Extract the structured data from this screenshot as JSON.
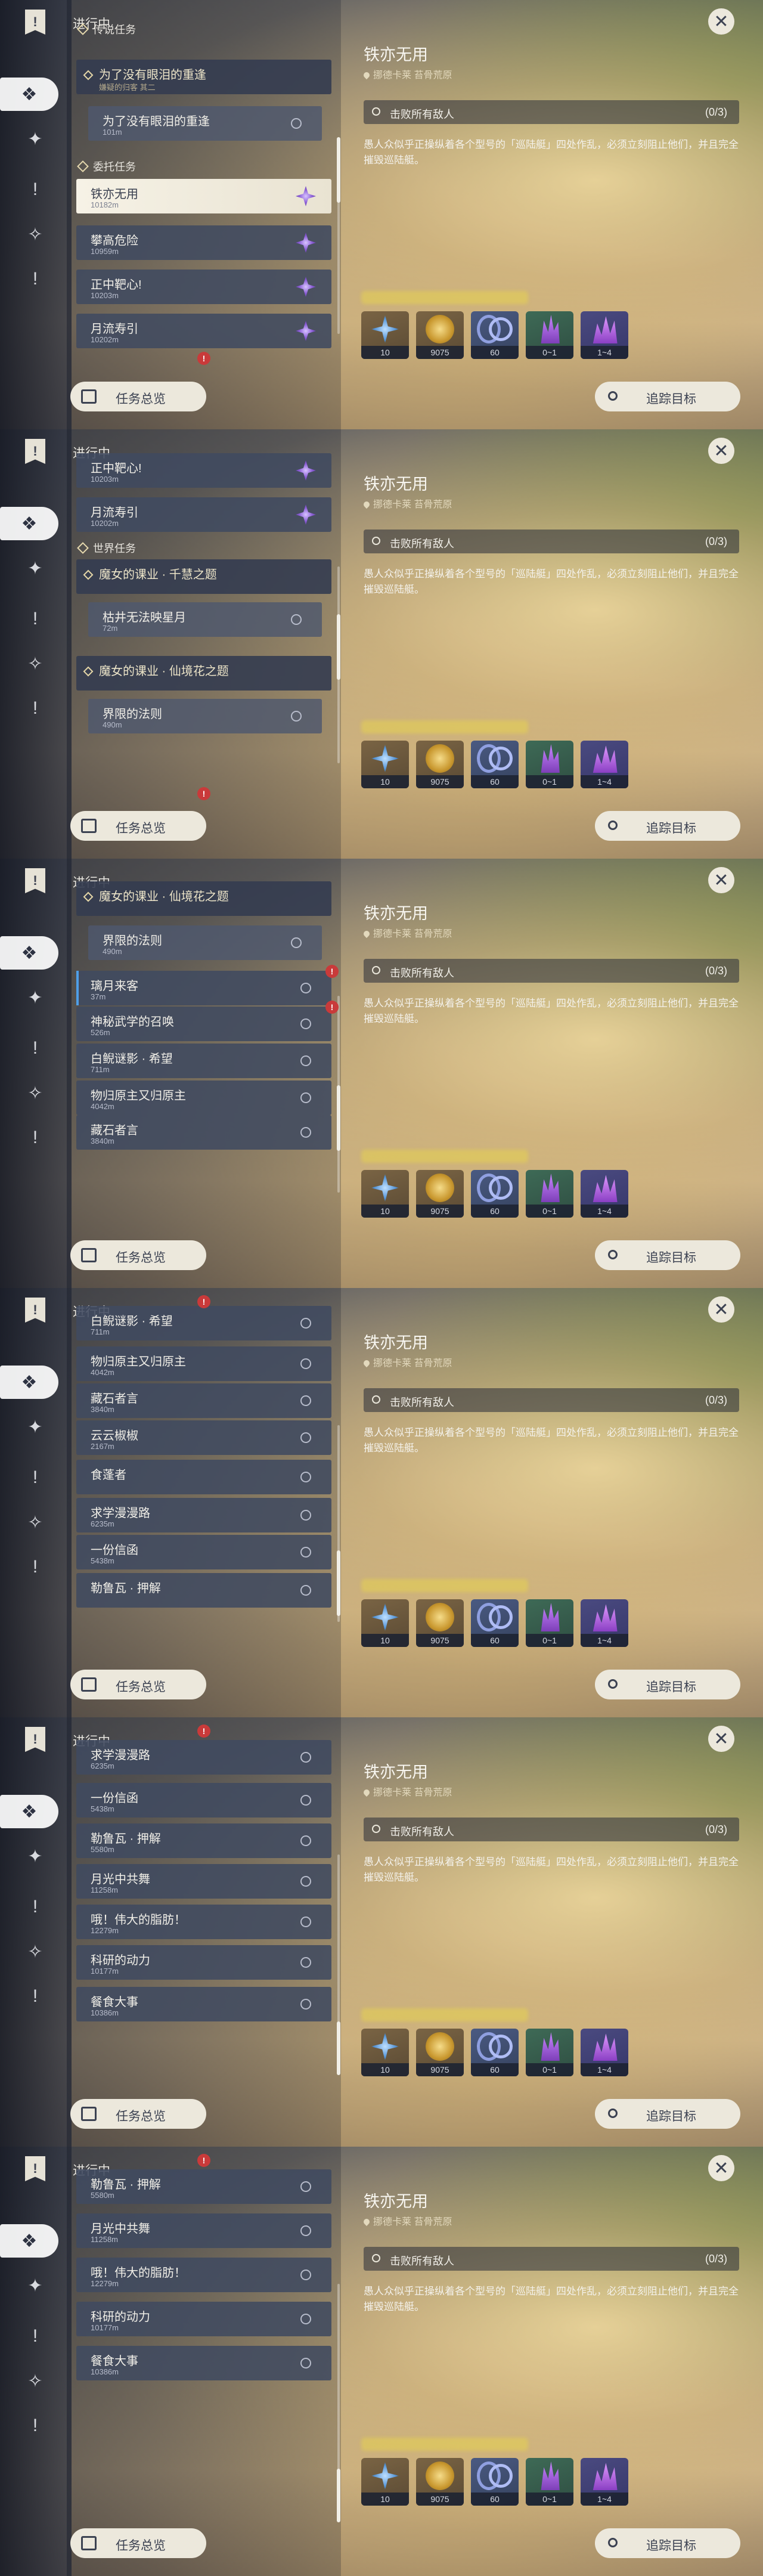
{
  "rail": {
    "top_icon": "!",
    "icons": [
      "quest-diamond-icon",
      "compass-icon",
      "exclamation-icon",
      "tangle-icon",
      "exclamation-icon"
    ]
  },
  "left": {
    "panel_title": "进行中",
    "overview_label": "任务总览"
  },
  "detail": {
    "title": "铁亦无用",
    "location": "挪德卡莱 苔骨荒原",
    "objective": "击败所有敌人",
    "progress": "(0/3)",
    "description": "愚人众似乎正操纵着各个型号的「巡陆艇」四处作乱，必须立刻阻止他们，并且完全摧毁巡陆艇。",
    "rewards": [
      {
        "name": "crystal-reward",
        "count": "10"
      },
      {
        "name": "mora-reward",
        "count": "9075"
      },
      {
        "name": "exp-reward",
        "count": "60"
      },
      {
        "name": "ore-reward",
        "count": "0~1"
      },
      {
        "name": "crystal-cluster-reward",
        "count": "1~4"
      }
    ],
    "track_label": "追踪目标",
    "close_label": "✕"
  },
  "shots": [
    {
      "items": [
        {
          "kind": "section",
          "top": 0,
          "label": "传说任务",
          "icon": "!"
        },
        {
          "kind": "gold",
          "title": "为了没有眼泪的重逢",
          "dist": "嫌疑的归客 其二"
        },
        {
          "kind": "sub",
          "title": "为了没有眼泪的重逢",
          "dist": "101m"
        },
        {
          "kind": "section",
          "label": "委托任务"
        },
        {
          "kind": "active",
          "title": "铁亦无用",
          "dist": "10182m",
          "gem": true
        },
        {
          "kind": "normal",
          "title": "攀高危险",
          "dist": "10959m",
          "gem": true
        },
        {
          "kind": "normal",
          "title": "正中靶心!",
          "dist": "10203m",
          "gem": true
        },
        {
          "kind": "normal",
          "title": "月流寿引",
          "dist": "10202m",
          "gem": true
        }
      ]
    },
    {
      "items": [
        {
          "kind": "normal",
          "title": "正中靶心!",
          "dist": "10203m",
          "gem": true
        },
        {
          "kind": "normal",
          "title": "月流寿引",
          "dist": "10202m",
          "gem": true
        },
        {
          "kind": "section",
          "label": "世界任务",
          "icon": "!"
        },
        {
          "kind": "gold",
          "title": "魔女的课业 · 千慧之题",
          "dist": ""
        },
        {
          "kind": "sub",
          "title": "枯井无法映星月",
          "dist": "72m"
        },
        {
          "kind": "gold",
          "title": "魔女的课业 · 仙境花之题",
          "dist": ""
        },
        {
          "kind": "sub",
          "title": "界限的法则",
          "dist": "490m"
        }
      ]
    },
    {
      "items": [
        {
          "kind": "gold",
          "title": "魔女的课业 · 仙境花之题",
          "dist": ""
        },
        {
          "kind": "sub",
          "title": "界限的法则",
          "dist": "490m"
        },
        {
          "kind": "normal",
          "title": "璃月来客",
          "dist": "37m",
          "blue": true
        },
        {
          "kind": "normal",
          "title": "神秘武学的召唤",
          "dist": "526m"
        },
        {
          "kind": "normal",
          "title": "白鲵谜影 · 希望",
          "dist": "711m"
        },
        {
          "kind": "normal",
          "title": "物归原主又归原主",
          "dist": "4042m"
        },
        {
          "kind": "normal",
          "title": "藏石者言",
          "dist": "3840m"
        }
      ]
    },
    {
      "items": [
        {
          "kind": "normal",
          "title": "白鲵谜影 · 希望",
          "dist": "711m"
        },
        {
          "kind": "normal",
          "title": "物归原主又归原主",
          "dist": "4042m"
        },
        {
          "kind": "normal",
          "title": "藏石者言",
          "dist": "3840m"
        },
        {
          "kind": "normal",
          "title": "云云椒椒",
          "dist": "2167m"
        },
        {
          "kind": "normal",
          "title": "食蓬者",
          "dist": ""
        },
        {
          "kind": "normal",
          "title": "求学漫漫路",
          "dist": "6235m"
        },
        {
          "kind": "normal",
          "title": "一份信函",
          "dist": "5438m"
        },
        {
          "kind": "normal",
          "title": "勒鲁瓦 · 押解",
          "dist": ""
        }
      ]
    },
    {
      "items": [
        {
          "kind": "normal",
          "title": "求学漫漫路",
          "dist": "6235m"
        },
        {
          "kind": "normal",
          "title": "一份信函",
          "dist": "5438m"
        },
        {
          "kind": "normal",
          "title": "勒鲁瓦 · 押解",
          "dist": "5580m"
        },
        {
          "kind": "normal",
          "title": "月光中共舞",
          "dist": "11258m"
        },
        {
          "kind": "normal",
          "title": "哦！伟大的脂肪！",
          "dist": "12279m"
        },
        {
          "kind": "normal",
          "title": "科研的动力",
          "dist": "10177m"
        },
        {
          "kind": "normal",
          "title": "餐食大事",
          "dist": "10386m"
        }
      ]
    },
    {
      "items": [
        {
          "kind": "normal",
          "title": "勒鲁瓦 · 押解",
          "dist": "5580m"
        },
        {
          "kind": "normal",
          "title": "月光中共舞",
          "dist": "11258m"
        },
        {
          "kind": "normal",
          "title": "哦！伟大的脂肪！",
          "dist": "12279m"
        },
        {
          "kind": "normal",
          "title": "科研的动力",
          "dist": "10177m"
        },
        {
          "kind": "normal",
          "title": "餐食大事",
          "dist": "10386m"
        }
      ]
    }
  ]
}
